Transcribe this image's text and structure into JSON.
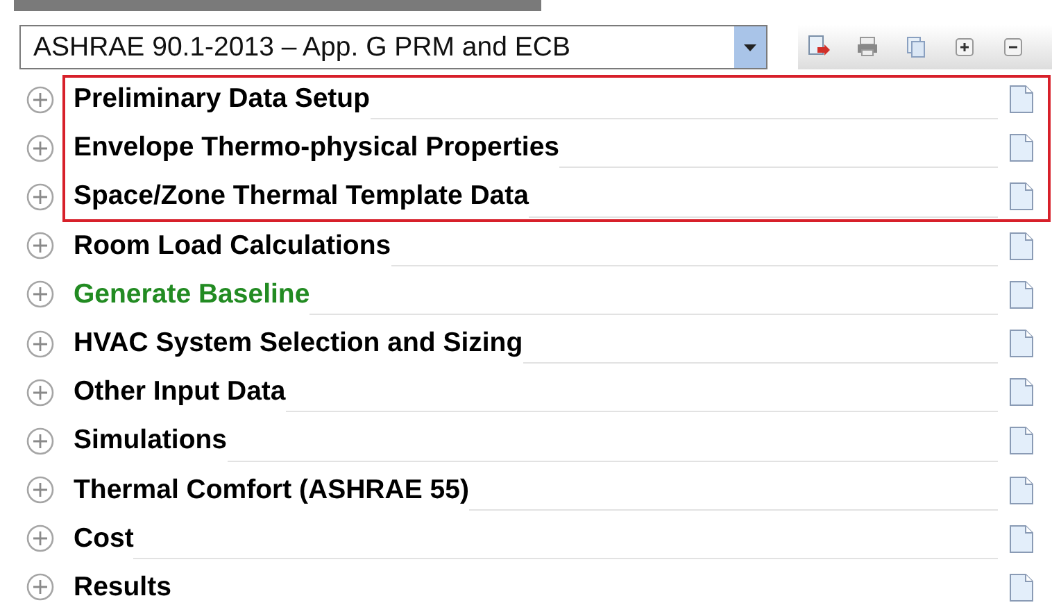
{
  "standard_dropdown": {
    "value": "ASHRAE 90.1-2013 – App. G PRM and ECB"
  },
  "toolbar": [
    {
      "kind": "export"
    },
    {
      "kind": "print"
    },
    {
      "kind": "copy"
    },
    {
      "kind": "expand"
    },
    {
      "kind": "collapse"
    }
  ],
  "sections": [
    {
      "label": "Preliminary Data Setup",
      "expanded": false,
      "highlighted": true,
      "color": "#000000"
    },
    {
      "label": "Envelope Thermo-physical Properties",
      "expanded": false,
      "highlighted": true,
      "color": "#000000"
    },
    {
      "label": "Space/Zone Thermal Template Data",
      "expanded": false,
      "highlighted": true,
      "color": "#000000"
    },
    {
      "label": "Room Load Calculations",
      "expanded": false,
      "highlighted": false,
      "color": "#000000"
    },
    {
      "label": "Generate Baseline",
      "expanded": false,
      "highlighted": false,
      "color": "#228b22"
    },
    {
      "label": "HVAC System Selection and Sizing",
      "expanded": false,
      "highlighted": false,
      "color": "#000000"
    },
    {
      "label": "Other Input Data",
      "expanded": false,
      "highlighted": false,
      "color": "#000000"
    },
    {
      "label": "Simulations",
      "expanded": false,
      "highlighted": false,
      "color": "#000000"
    },
    {
      "label": "Thermal Comfort (ASHRAE 55)",
      "expanded": false,
      "highlighted": false,
      "color": "#000000"
    },
    {
      "label": "Cost",
      "expanded": false,
      "highlighted": false,
      "color": "#000000"
    },
    {
      "label": "Results",
      "expanded": false,
      "highlighted": false,
      "color": "#000000"
    }
  ]
}
